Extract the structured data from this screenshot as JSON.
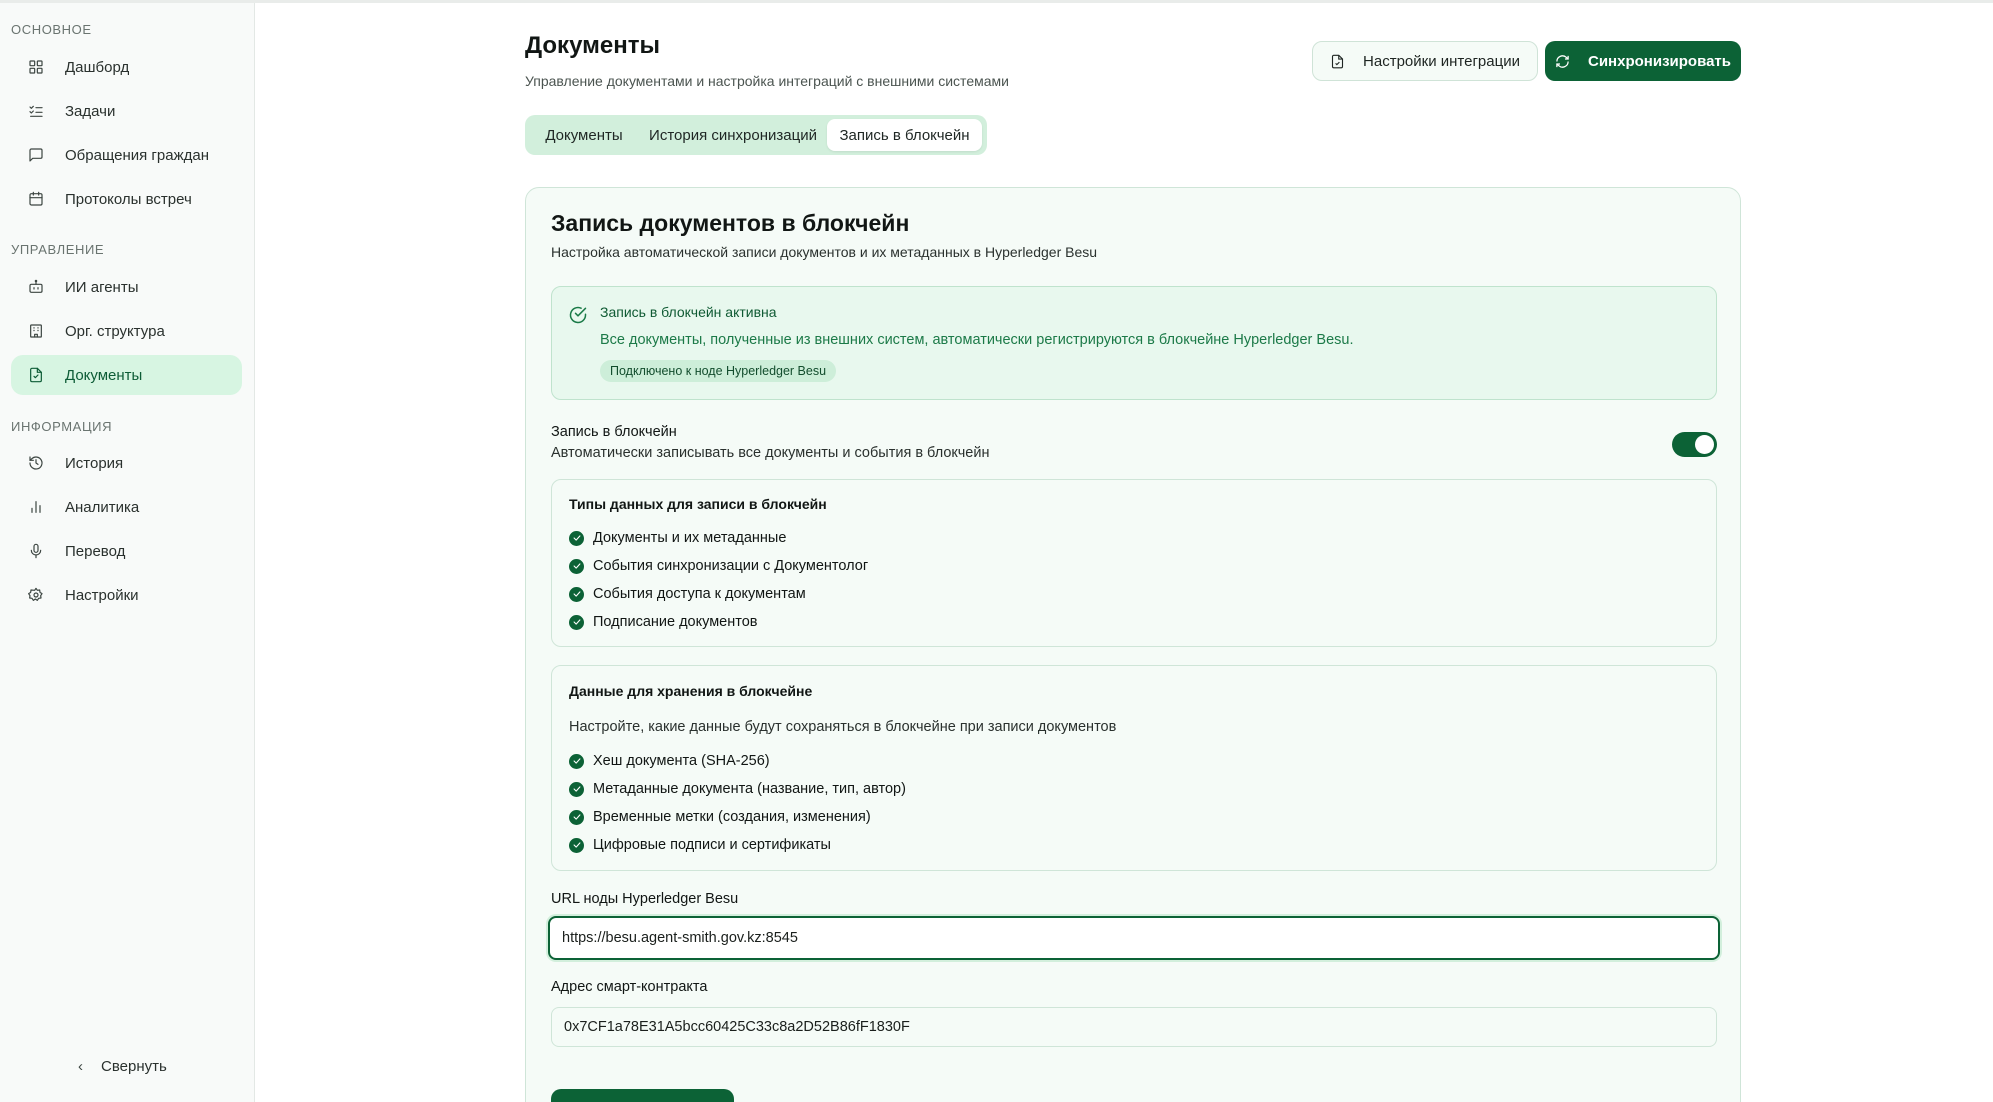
{
  "sidebar": {
    "sections": [
      {
        "title": "ОСНОВНОЕ",
        "items": [
          {
            "label": "Дашборд",
            "icon": "grid-icon"
          },
          {
            "label": "Задачи",
            "icon": "list-check-icon"
          },
          {
            "label": "Обращения граждан",
            "icon": "message-square-icon"
          },
          {
            "label": "Протоколы встреч",
            "icon": "calendar-icon"
          }
        ]
      },
      {
        "title": "УПРАВЛЕНИЕ",
        "items": [
          {
            "label": "ИИ агенты",
            "icon": "bot-icon"
          },
          {
            "label": "Орг. структура",
            "icon": "building-icon"
          },
          {
            "label": "Документы",
            "icon": "file-icon",
            "active": true
          }
        ]
      },
      {
        "title": "ИНФОРМАЦИЯ",
        "items": [
          {
            "label": "История",
            "icon": "history-icon"
          },
          {
            "label": "Аналитика",
            "icon": "bar-chart-icon"
          },
          {
            "label": "Перевод",
            "icon": "mic-icon"
          },
          {
            "label": "Настройки",
            "icon": "gear-icon"
          }
        ]
      }
    ],
    "collapse_label": "Свернуть"
  },
  "header": {
    "title": "Документы",
    "subtitle": "Управление документами и настройка интеграций с внешними системами",
    "integration_button": "Настройки интеграции",
    "sync_button": "Синхронизировать"
  },
  "tabs": [
    {
      "label": "Документы"
    },
    {
      "label": "История синхронизаций"
    },
    {
      "label": "Запись в блокчейн",
      "active": true
    }
  ],
  "card": {
    "title": "Запись документов в блокчейн",
    "subtitle": "Настройка автоматической записи документов и их метаданных в Hyperledger Besu",
    "alert": {
      "title": "Запись в блокчейн активна",
      "text": "Все документы, полученные из внешних систем, автоматически регистрируются в блокчейне Hyperledger Besu.",
      "badge": "Подключено к ноде Hyperledger Besu"
    },
    "toggle": {
      "label": "Запись в блокчейн",
      "description": "Автоматически записывать все документы и события в блокчейн",
      "enabled": true
    },
    "data_types": {
      "title": "Типы данных для записи в блокчейн",
      "items": [
        "Документы и их метаданные",
        "События синхронизации с Документолог",
        "События доступа к документам",
        "Подписание документов"
      ]
    },
    "storage": {
      "title": "Данные для хранения в блокчейне",
      "description": "Настройте, какие данные будут сохраняться в блокчейне при записи документов",
      "items": [
        "Хеш документа (SHA-256)",
        "Метаданные документа (название, тип, автор)",
        "Временные метки (создания, изменения)",
        "Цифровые подписи и сертификаты"
      ]
    },
    "node_url": {
      "label": "URL ноды Hyperledger Besu",
      "value": "https://besu.agent-smith.gov.kz:8545"
    },
    "contract": {
      "label": "Адрес смарт-контракта",
      "value": "0x7CF1a78E31A5bcc60425C33c8a2D52B86fF1830F"
    }
  },
  "colors": {
    "accent": "#0c6236",
    "accent_light": "#d7f5e2",
    "card_bg": "#f5fbf7"
  }
}
